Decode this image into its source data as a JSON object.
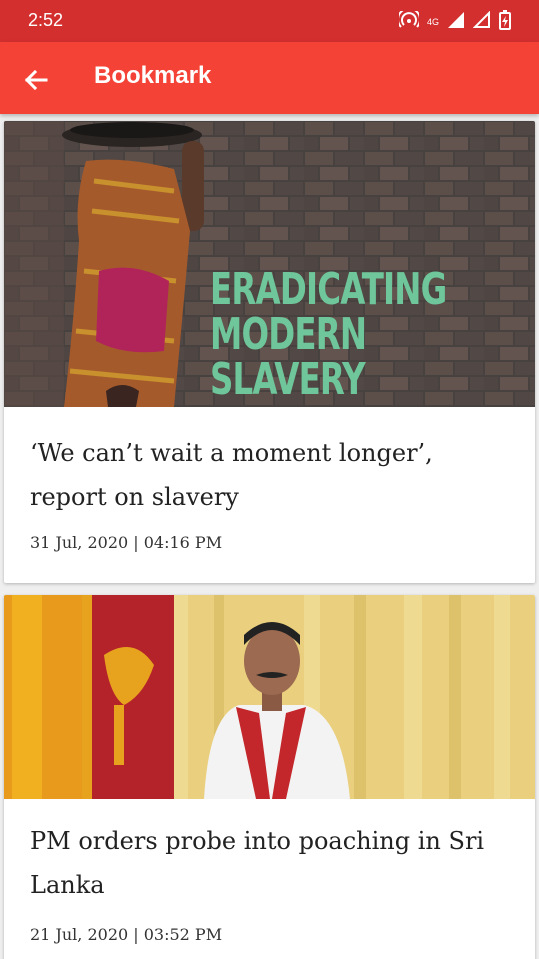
{
  "status_bar": {
    "time": "2:52",
    "network": "4G"
  },
  "app_bar": {
    "title": "Bookmark",
    "back_icon": "arrow-left-icon"
  },
  "colors": {
    "status_bar": "#d32f2f",
    "app_bar": "#f44336",
    "background": "#efefef",
    "card": "#ffffff",
    "overlay_text": "#6ec69a"
  },
  "bookmarks": [
    {
      "image_overlay_lines": [
        "ERADICATING",
        "MODERN",
        "SLAVERY"
      ],
      "headline": "‘We can’t wait a moment longer’, report on slavery",
      "date": "31 Jul, 2020 | 04:16 PM"
    },
    {
      "headline": "PM orders probe into poaching in Sri Lanka",
      "date": "21 Jul, 2020 | 03:52 PM"
    }
  ]
}
